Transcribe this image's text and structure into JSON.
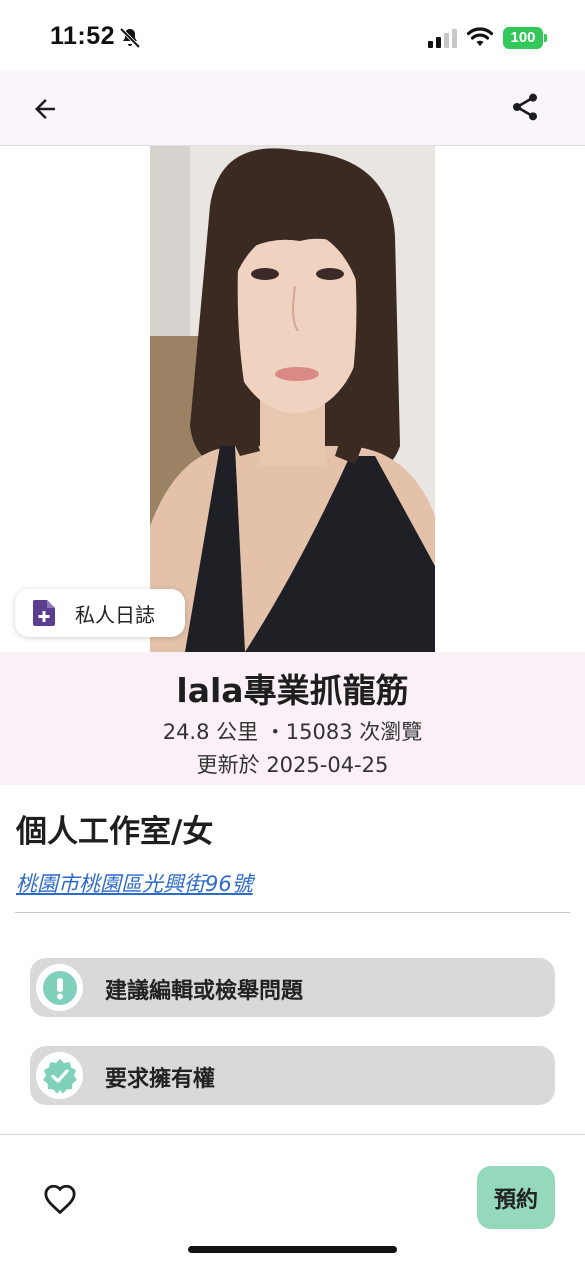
{
  "status_bar": {
    "time": "11:52",
    "battery": "100",
    "battery_color": "#34c759"
  },
  "icons": {
    "back": "arrow-left-icon",
    "share": "share-icon",
    "diary": "note-add-icon",
    "report": "alert-icon",
    "claim": "verified-badge-icon",
    "favorite": "heart-outline-icon"
  },
  "photo": {
    "description_icon": "profile-photo"
  },
  "diary_button": {
    "label": "私人日誌"
  },
  "profile": {
    "name": "lala專業抓龍筋",
    "meta": "24.8 公里 ・15083 次瀏覽",
    "updated": "更新於 2025-04-25",
    "studio_type": "個人工作室/女",
    "address": "桃園市桃園區光興街96號"
  },
  "actions": {
    "report_label": "建議編輯或檢舉問題",
    "claim_label": "要求擁有權"
  },
  "bottom_bar": {
    "book_label": "預約",
    "accent": "#95d9bd"
  },
  "colors": {
    "header_bg": "#fbf5fb",
    "info_bg": "#fbf0f8",
    "link": "#2d6bc9",
    "badge_teal": "#7fd1bc",
    "diary_purple": "#5b3f8f"
  }
}
